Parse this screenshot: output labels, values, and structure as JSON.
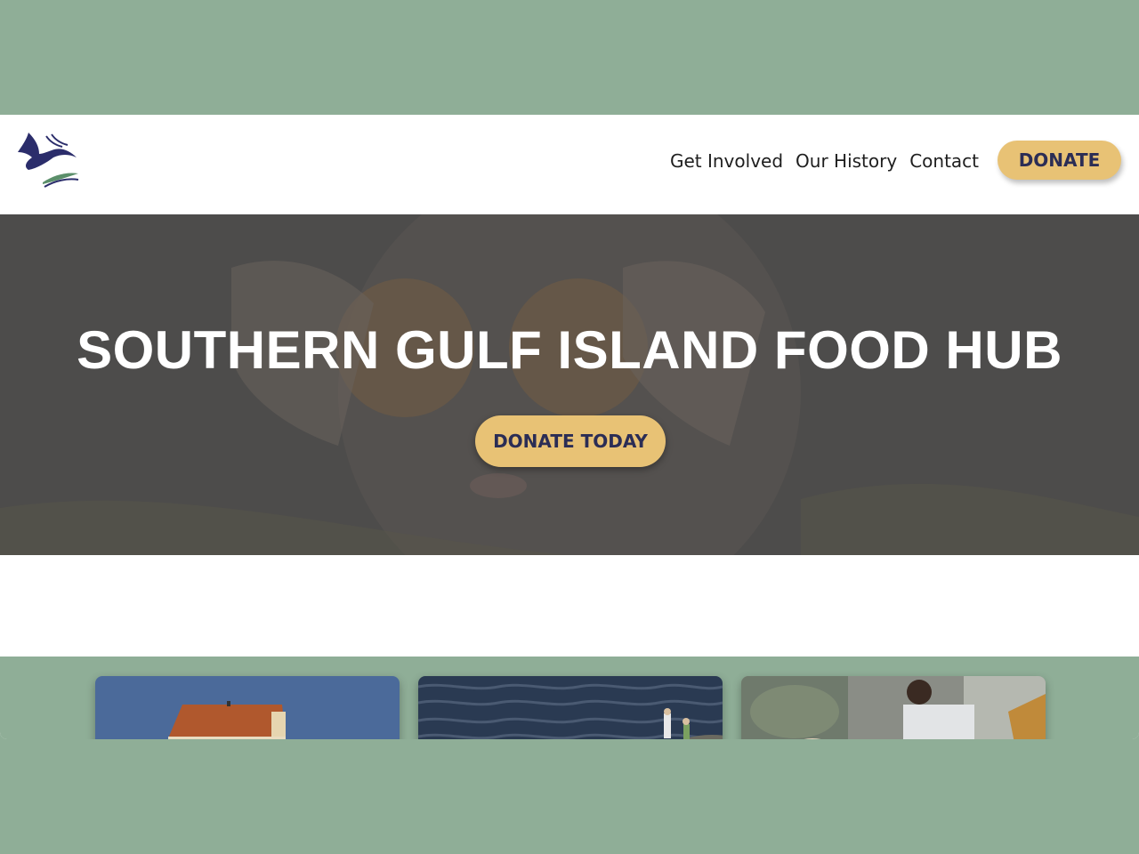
{
  "brand": {
    "logo_icon": "swallow-bird-icon"
  },
  "nav": {
    "items": [
      {
        "label": "Get Involved"
      },
      {
        "label": "Our History"
      },
      {
        "label": "Contact"
      }
    ],
    "donate_label": "DONATE"
  },
  "hero": {
    "title": "SOUTHERN GULF ISLAND FOOD HUB",
    "button_label": "DONATE TODAY"
  },
  "cards": [
    {
      "image": "house-roof-photo"
    },
    {
      "image": "ocean-waves-photo"
    },
    {
      "image": "volunteers-photo"
    }
  ],
  "colors": {
    "page_background": "#8fae97",
    "accent_button": "#e8c275",
    "button_text": "#2b2d55",
    "hero_overlay": "#4a4a4a",
    "logo_blue": "#2b2d6b",
    "logo_green": "#5b8f6a"
  }
}
